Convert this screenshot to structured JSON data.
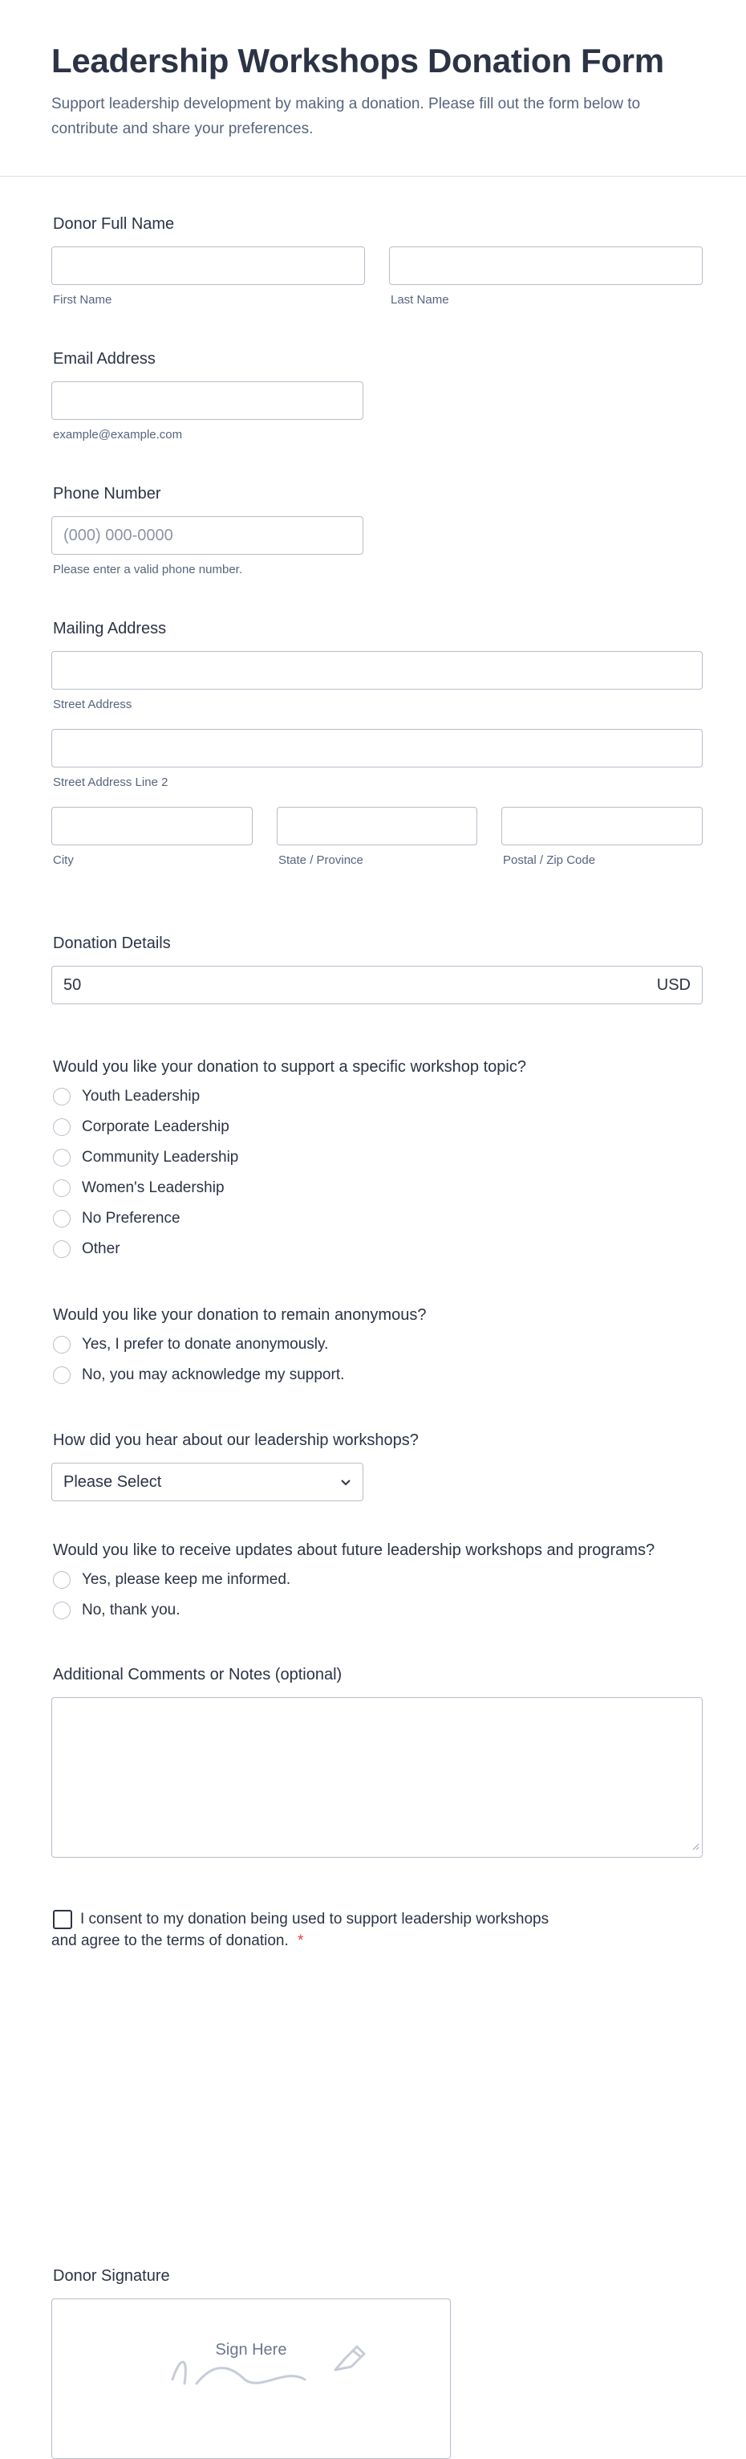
{
  "header": {
    "title": "Leadership Workshops Donation Form",
    "subtitle": "Support leadership development by making a donation. Please fill out the form below to contribute and share your preferences."
  },
  "name": {
    "label": "Donor Full Name",
    "first_value": "",
    "last_value": "",
    "first_sublabel": "First Name",
    "last_sublabel": "Last Name"
  },
  "email": {
    "label": "Email Address",
    "value": "",
    "sublabel": "example@example.com"
  },
  "phone": {
    "label": "Phone Number",
    "placeholder": "(000) 000-0000",
    "sublabel": "Please enter a valid phone number."
  },
  "address": {
    "label": "Mailing Address",
    "street_sublabel": "Street Address",
    "street2_sublabel": "Street Address Line 2",
    "city_sublabel": "City",
    "state_sublabel": "State / Province",
    "zip_sublabel": "Postal / Zip Code"
  },
  "donation": {
    "label": "Donation Details",
    "amount": "50",
    "currency": "USD"
  },
  "topic": {
    "question": "Would you like your donation to support a specific workshop topic?",
    "options": [
      "Youth Leadership",
      "Corporate Leadership",
      "Community Leadership",
      "Women's Leadership",
      "No Preference",
      "Other"
    ]
  },
  "anonymous": {
    "question": "Would you like your donation to remain anonymous?",
    "options": [
      "Yes, I prefer to donate anonymously.",
      "No, you may acknowledge my support."
    ]
  },
  "hear": {
    "question": "How did you hear about our leadership workshops?",
    "selected": "Please Select"
  },
  "updates": {
    "question": "Would you like to receive updates about future leadership workshops and programs?",
    "options": [
      "Yes, please keep me informed.",
      "No, thank you."
    ]
  },
  "comments": {
    "label": "Additional Comments or Notes (optional)",
    "value": ""
  },
  "consent": {
    "text_line1": "I consent to my donation being used to support leadership workshops",
    "text_line2": "and agree to the terms of donation.",
    "required_mark": "*"
  },
  "signature": {
    "label": "Donor Signature",
    "hint": "Sign Here"
  },
  "colors": {
    "accent": "#2c3345",
    "muted": "#57647e",
    "border": "#b8bdc9",
    "required": "#f23a3c"
  }
}
